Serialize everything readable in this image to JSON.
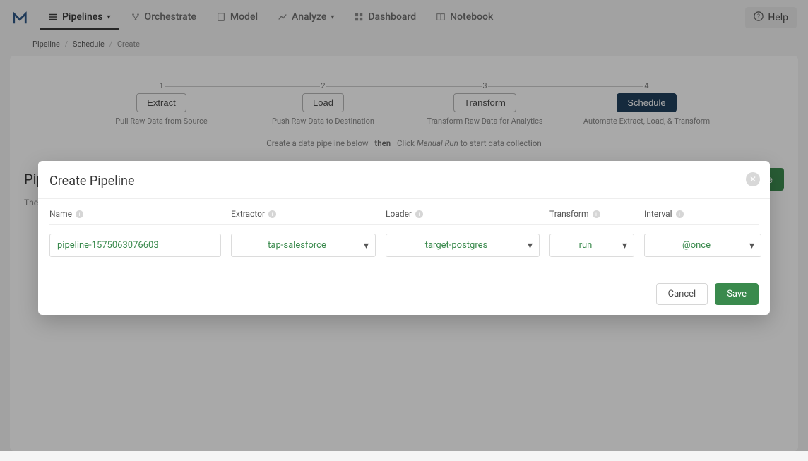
{
  "nav": {
    "pipelines": "Pipelines",
    "orchestrate": "Orchestrate",
    "model": "Model",
    "analyze": "Analyze",
    "dashboard": "Dashboard",
    "notebook": "Notebook",
    "help": "Help"
  },
  "breadcrumb": {
    "a": "Pipeline",
    "b": "Schedule",
    "c": "Create"
  },
  "steps": [
    {
      "num": "1",
      "label": "Extract",
      "desc": "Pull Raw Data from Source"
    },
    {
      "num": "2",
      "label": "Load",
      "desc": "Push Raw Data to Destination"
    },
    {
      "num": "3",
      "label": "Transform",
      "desc": "Transform Raw Data for Analytics"
    },
    {
      "num": "4",
      "label": "Schedule",
      "desc": "Automate Extract, Load, & Transform"
    }
  ],
  "intro": {
    "a": "Create a data pipeline below",
    "then": "then",
    "b1": "Click ",
    "mr": "Manual Run",
    "b2": " to start data collection"
  },
  "page": {
    "pipelines_title": "Pipelines",
    "create_btn": "Create",
    "empty": "There are no pipelines scheduled yet."
  },
  "modal": {
    "title": "Create Pipeline",
    "labels": {
      "name": "Name",
      "extractor": "Extractor",
      "loader": "Loader",
      "transform": "Transform",
      "interval": "Interval"
    },
    "values": {
      "name": "pipeline-1575063076603",
      "extractor": "tap-salesforce",
      "loader": "target-postgres",
      "transform": "run",
      "interval": "@once"
    },
    "buttons": {
      "cancel": "Cancel",
      "save": "Save"
    }
  }
}
